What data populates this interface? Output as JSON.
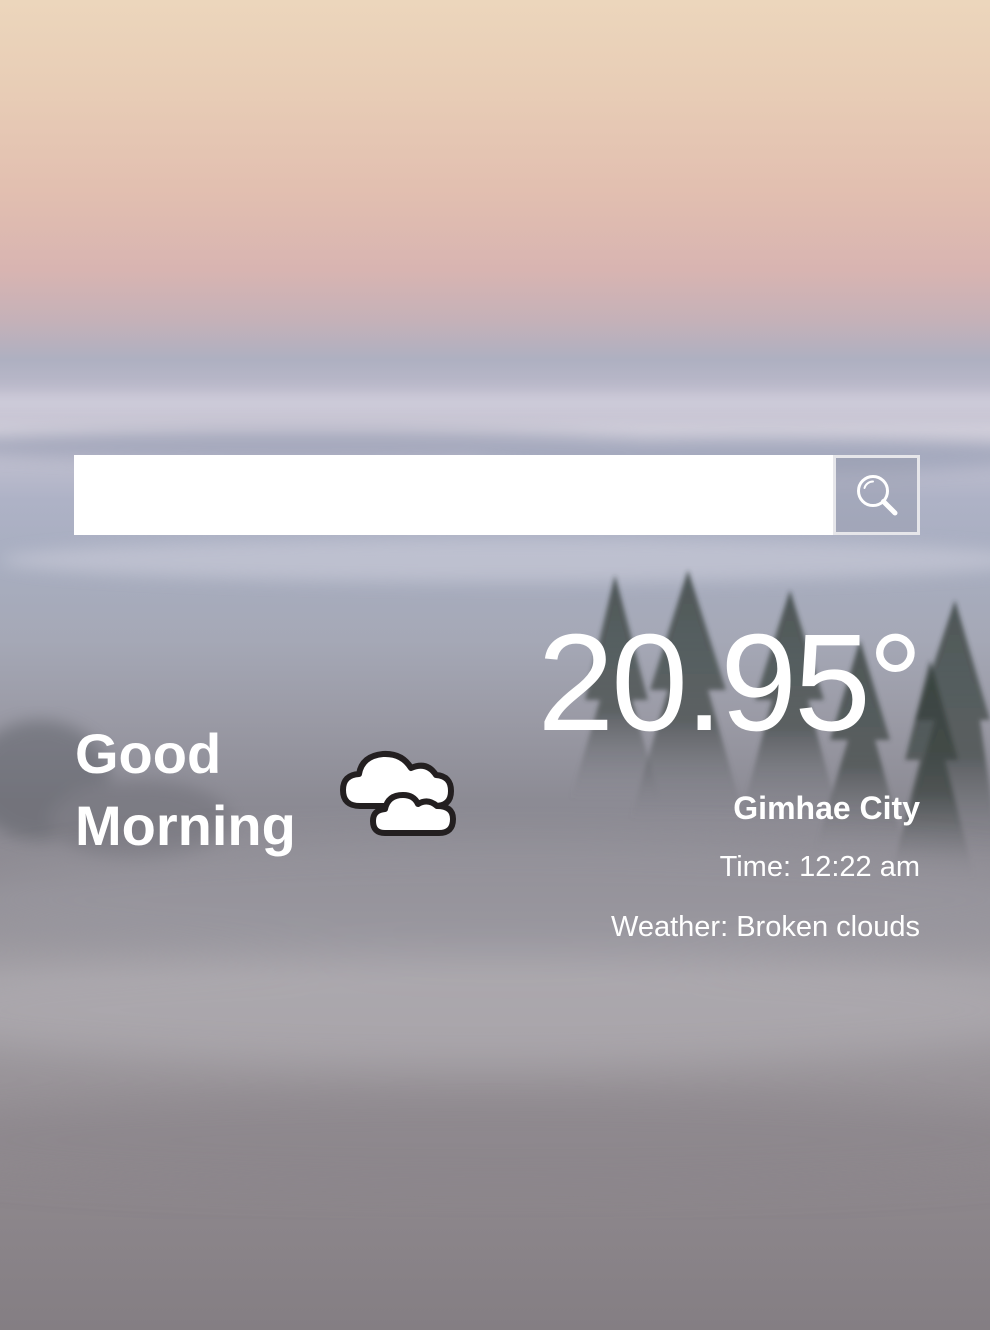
{
  "search": {
    "value": "",
    "placeholder": "",
    "button_icon": "search-icon"
  },
  "greeting": {
    "line1": "Good",
    "line2": "Morning"
  },
  "weather": {
    "temperature": "20.95°",
    "city": "Gimhae City",
    "time_label": "Time:",
    "time_value": "12:22 am",
    "condition_label": "Weather:",
    "condition_value": "Broken clouds",
    "icon": "broken-clouds-icon"
  },
  "colors": {
    "text": "#ffffff",
    "search_bg": "#ffffff",
    "search_button_border": "#e6e6ea",
    "sky_top": "#ecd6bc",
    "sky_pink": "#d8b4b1",
    "fog": "#a5a8b6",
    "tree": "#2f3a35"
  }
}
